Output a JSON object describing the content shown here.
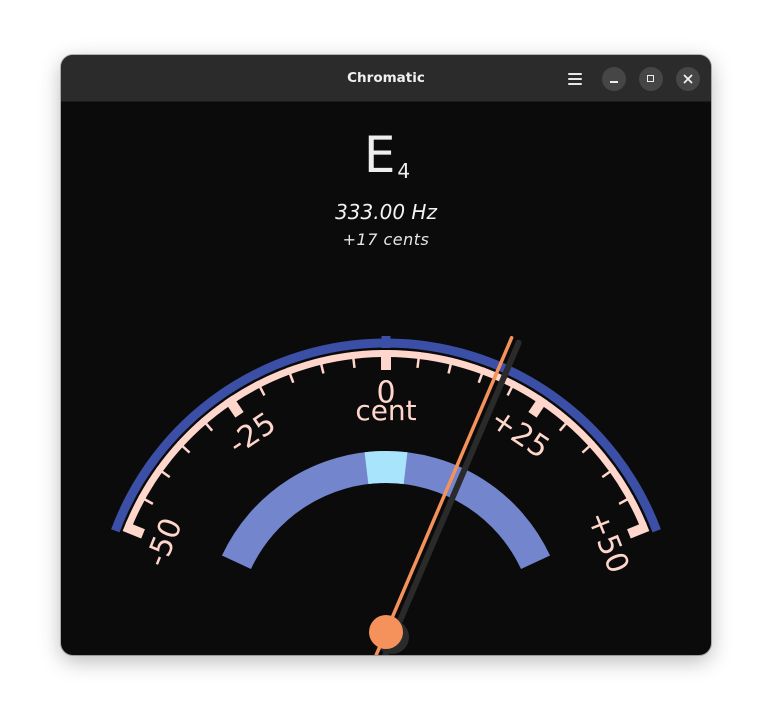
{
  "window": {
    "title": "Chromatic"
  },
  "header_buttons": {
    "menu": "menu-icon",
    "minimize": "minimize-icon",
    "maximize": "maximize-icon",
    "close": "close-icon"
  },
  "tuner": {
    "note": "E",
    "octave": "4",
    "frequency": "333.00 Hz",
    "cents_text": "+17 cents",
    "cents_value": 17
  },
  "dial": {
    "unit_label": "cent",
    "tick_labels": [
      {
        "value": -50,
        "text": "-50"
      },
      {
        "value": -25,
        "text": "-25"
      },
      {
        "value": 0,
        "text": "0"
      },
      {
        "value": 25,
        "text": "+25"
      },
      {
        "value": 50,
        "text": "+50"
      }
    ],
    "range": [
      -50,
      50
    ],
    "in_tune_zone": [
      -5,
      5
    ]
  },
  "colors": {
    "outer_band": "#3b4fa6",
    "scale": "#ffd6cb",
    "inner_band": "#7385cc",
    "in_tune": "#a8e4fb",
    "needle": "#f5915a",
    "background": "#0b0b0b"
  }
}
